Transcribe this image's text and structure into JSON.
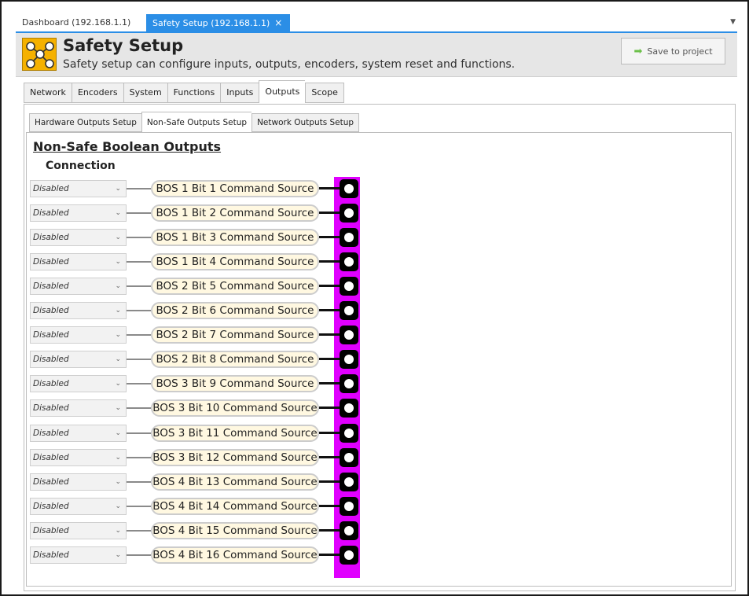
{
  "doc_tabs": [
    {
      "label": "Dashboard (192.168.1.1)"
    },
    {
      "label": "Safety Setup (192.168.1.1)",
      "close": "×"
    }
  ],
  "header": {
    "title": "Safety Setup",
    "subtitle": "Safety setup can configure inputs, outputs, encoders, system reset and functions.",
    "save_button": "Save to project",
    "logo_color": "#f5b100"
  },
  "main_tabs": [
    "Network",
    "Encoders",
    "System",
    "Functions",
    "Inputs",
    "Outputs",
    "Scope"
  ],
  "main_tab_active": "Outputs",
  "sub_tabs": [
    "Hardware Outputs Setup",
    "Non-Safe Outputs Setup",
    "Network Outputs Setup"
  ],
  "sub_tab_active": "Non-Safe Outputs Setup",
  "section": {
    "title": "Non-Safe Boolean Outputs",
    "column_label": "Connection",
    "bar_color": "#e000ff"
  },
  "outputs": [
    {
      "connection": "Disabled",
      "source": "BOS 1 Bit 1 Command Source"
    },
    {
      "connection": "Disabled",
      "source": "BOS 1 Bit 2 Command Source"
    },
    {
      "connection": "Disabled",
      "source": "BOS 1 Bit 3 Command Source"
    },
    {
      "connection": "Disabled",
      "source": "BOS 1 Bit 4 Command Source"
    },
    {
      "connection": "Disabled",
      "source": "BOS 2 Bit 5 Command Source"
    },
    {
      "connection": "Disabled",
      "source": "BOS 2 Bit 6 Command Source"
    },
    {
      "connection": "Disabled",
      "source": "BOS 2 Bit 7 Command Source"
    },
    {
      "connection": "Disabled",
      "source": "BOS 2 Bit 8 Command Source"
    },
    {
      "connection": "Disabled",
      "source": "BOS 3 Bit 9 Command Source"
    },
    {
      "connection": "Disabled",
      "source": "BOS 3 Bit 10 Command Source"
    },
    {
      "connection": "Disabled",
      "source": "BOS 3 Bit 11 Command Source"
    },
    {
      "connection": "Disabled",
      "source": "BOS 3 Bit 12 Command Source"
    },
    {
      "connection": "Disabled",
      "source": "BOS 4 Bit 13 Command Source"
    },
    {
      "connection": "Disabled",
      "source": "BOS 4 Bit 14 Command Source"
    },
    {
      "connection": "Disabled",
      "source": "BOS 4 Bit 15 Command Source"
    },
    {
      "connection": "Disabled",
      "source": "BOS 4 Bit 16 Command Source"
    }
  ]
}
